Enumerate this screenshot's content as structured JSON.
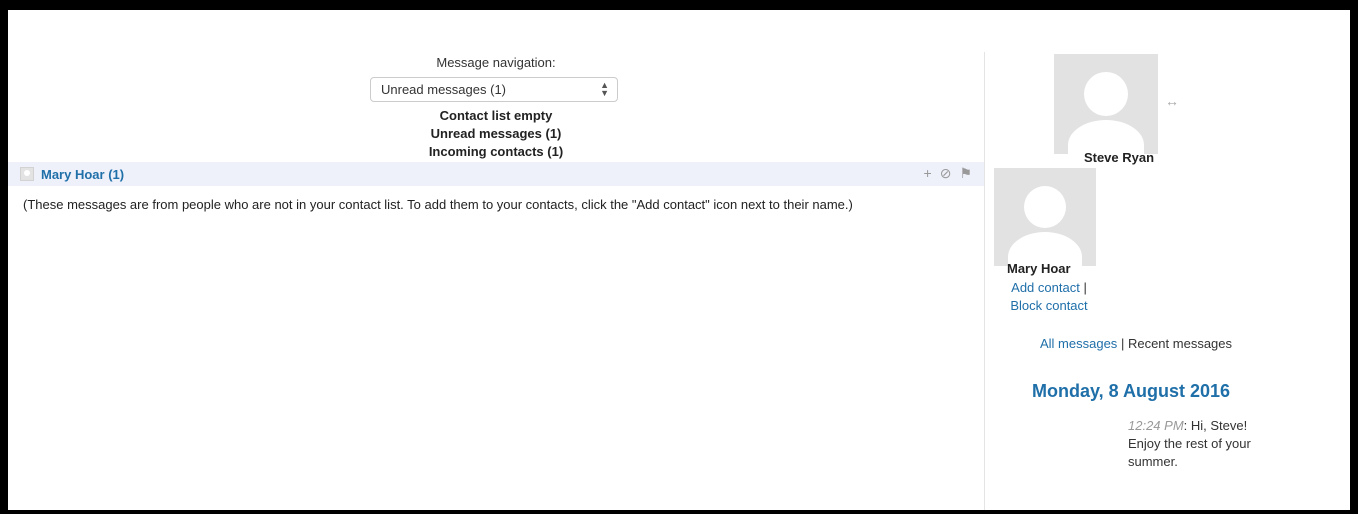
{
  "navigation": {
    "label": "Message navigation:",
    "selected": "Unread messages (1)",
    "links": [
      "Contact list empty",
      "Unread messages (1)",
      "Incoming contacts (1)"
    ]
  },
  "contact_row": {
    "name": "Mary Hoar (1)",
    "icons": [
      "add-icon",
      "block-icon",
      "history-icon"
    ]
  },
  "notice": "(These messages are from people who are not in your contact list. To add them to your contacts, click the \"Add contact\" icon next to their name.)",
  "current_user": {
    "name": "Steve Ryan"
  },
  "other_user": {
    "name": "Mary Hoar",
    "add_contact": "Add contact",
    "separator": "|",
    "block_contact": "Block contact"
  },
  "message_links": {
    "all": "All messages",
    "separator": "|",
    "recent": "Recent messages"
  },
  "conversation": {
    "date": "Monday, 8 August 2016",
    "messages": [
      {
        "time": "12:24 PM",
        "text": ": Hi, Steve! Enjoy the rest of your summer."
      }
    ]
  },
  "colors": {
    "link": "#1f6fa9",
    "contact_bar": "#eef0fa"
  }
}
